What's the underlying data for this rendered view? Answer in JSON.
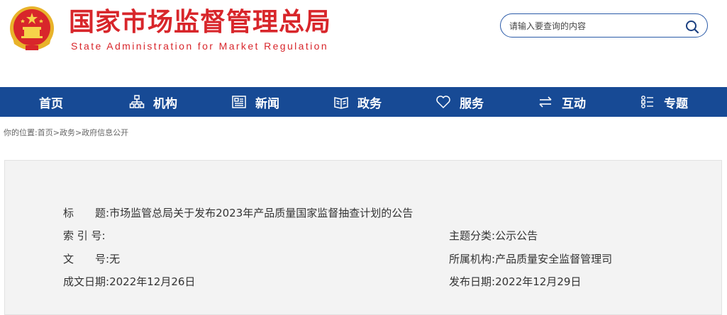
{
  "header": {
    "title_cn": "国家市场监督管理总局",
    "title_en": "State Administration for Market Regulation",
    "emblem_icon": "national-emblem-icon",
    "brand_color": "#d8262b"
  },
  "search": {
    "placeholder": "请输入要查询的内容",
    "icon": "search-icon"
  },
  "nav": {
    "color": "#174a95",
    "items": [
      {
        "label": "首页",
        "icon": ""
      },
      {
        "label": "机构",
        "icon": "org-chart-icon"
      },
      {
        "label": "新闻",
        "icon": "newspaper-icon"
      },
      {
        "label": "政务",
        "icon": "open-book-icon"
      },
      {
        "label": "服务",
        "icon": "heart-icon"
      },
      {
        "label": "互动",
        "icon": "swap-arrows-icon"
      },
      {
        "label": "专题",
        "icon": "grid-list-icon"
      }
    ]
  },
  "breadcrumb": {
    "prefix": "你的位置:",
    "items": [
      "首页",
      "政务",
      "政府信息公开"
    ],
    "separator": ">"
  },
  "info": {
    "title_label": "标　　题:",
    "title_value": "市场监管总局关于发布2023年产品质量国家监督抽查计划的公告",
    "index_label": "索 引 号:",
    "index_value": "",
    "topic_label": "主题分类:",
    "topic_value": "公示公告",
    "docno_label": "文　　号:",
    "docno_value": "无",
    "org_label": "所属机构:",
    "org_value": "产品质量安全监督管理司",
    "date_label": "成文日期:",
    "date_value": "2022年12月26日",
    "pubdate_label": "发布日期:",
    "pubdate_value": "2022年12月29日"
  }
}
